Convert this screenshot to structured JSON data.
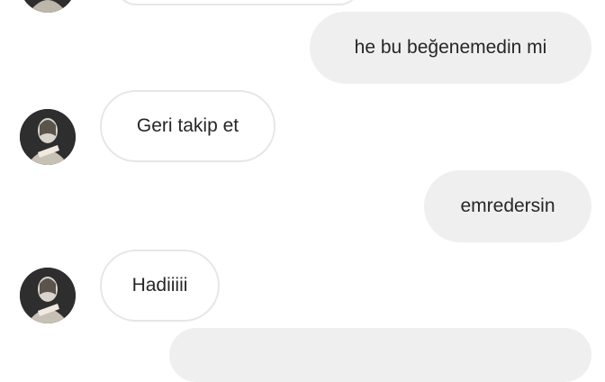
{
  "colors": {
    "sent_bubble_bg": "#efefef",
    "received_bubble_border": "#e6e6e6",
    "text": "#262626"
  },
  "messages": [
    {
      "id": "m1",
      "direction": "sent",
      "text": "he bu beğenemedin mi"
    },
    {
      "id": "m2",
      "direction": "received",
      "text": "Geri takip et",
      "avatar_icon": "user-avatar-icon"
    },
    {
      "id": "m3",
      "direction": "sent",
      "text": "emredersin"
    },
    {
      "id": "m4",
      "direction": "received",
      "text": "Hadiiiii",
      "avatar_icon": "user-avatar-icon"
    }
  ]
}
